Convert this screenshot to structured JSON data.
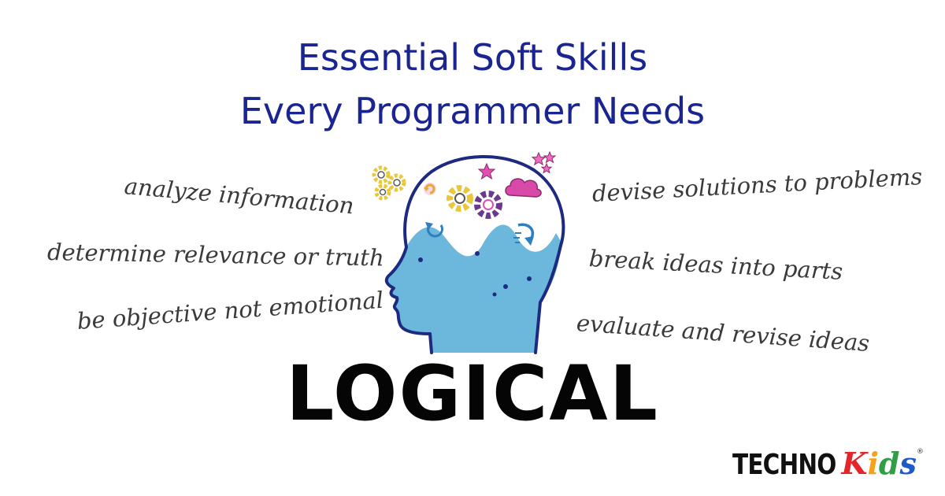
{
  "title": {
    "line1": "Essential Soft Skills",
    "line2": "Every Programmer Needs"
  },
  "left_phrases": [
    "analyze information",
    "determine relevance or truth",
    "be objective not emotional"
  ],
  "right_phrases": [
    "devise solutions to problems",
    "break ideas into parts",
    "evaluate and revise ideas"
  ],
  "skill_word": "LOGICAL",
  "logo": {
    "part1": "TECHNO",
    "kids_letters": [
      "K",
      "i",
      "d",
      "s"
    ],
    "kids_colors": [
      "#e2262a",
      "#f7a11a",
      "#2f9e44",
      "#1f5bc6"
    ],
    "registered": "®"
  },
  "graphic_icons": [
    "head-profile-icon",
    "gear-icon",
    "star-icon",
    "cloud-icon",
    "circular-arrow-icon",
    "curved-arrow-icon"
  ],
  "colors": {
    "title": "#1a2592",
    "phrase_text": "#3a3a3a",
    "head_outline": "#1e2a80",
    "head_fill": "#6bb8dc",
    "gear_yellow": "#e8c83a",
    "gear_purple": "#6a3a8e",
    "pink": "#d94aa8",
    "big_word": "#050505"
  }
}
